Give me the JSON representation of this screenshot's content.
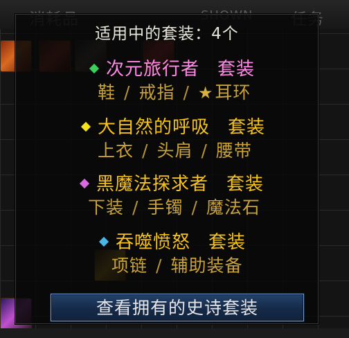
{
  "background": {
    "tabs": [
      "消耗品",
      "SHOWN",
      "任务"
    ]
  },
  "tooltip": {
    "title": "适用中的套装：4个",
    "sets": [
      {
        "name": "次元旅行者",
        "suffix": "套装",
        "color": "#ff8ae6",
        "suffix_color": "#ff8ae6",
        "diamond_color": "#39d15a",
        "parts": [
          "鞋",
          "戒指",
          "耳环"
        ],
        "starred_part_index": 2
      },
      {
        "name": "大自然的呼吸",
        "suffix": "套装",
        "color": "#f6c21c",
        "suffix_color": "#f6c21c",
        "diamond_color": "#f6e21c",
        "parts": [
          "上衣",
          "头肩",
          "腰带"
        ]
      },
      {
        "name": "黑魔法探求者",
        "suffix": "套装",
        "color": "#f6c21c",
        "suffix_color": "#f6c21c",
        "diamond_color": "#d96ae0",
        "parts": [
          "下装",
          "手镯",
          "魔法石"
        ]
      },
      {
        "name": "吞噬愤怒",
        "suffix": "套装",
        "color": "#f6c21c",
        "suffix_color": "#f6c21c",
        "diamond_color": "#4ab6e8",
        "parts": [
          "项链",
          "辅助装备"
        ]
      }
    ],
    "separator": "/",
    "button_label": "查看拥有的史诗套装"
  },
  "icons": {
    "star": "star-icon",
    "diamond": "diamond-bullet-icon"
  }
}
